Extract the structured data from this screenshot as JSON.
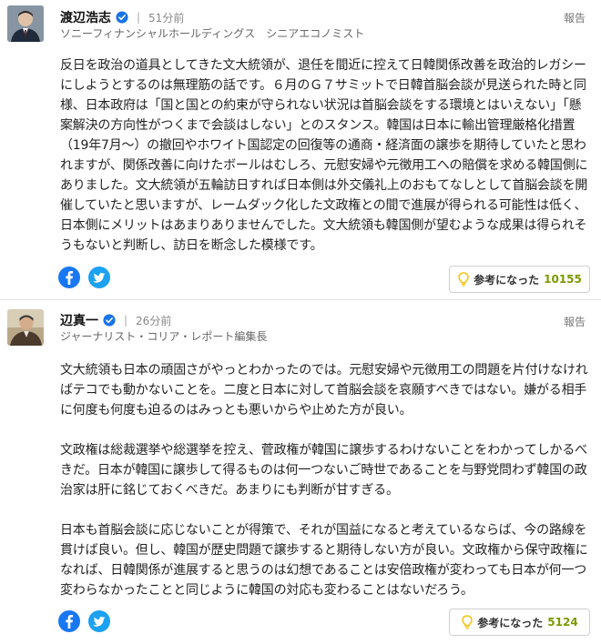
{
  "comments": [
    {
      "author": "渡辺浩志",
      "separator": "|",
      "time": "51分前",
      "affiliation": "ソニーフィナンシャルホールディングス　シニアエコノミスト",
      "report_label": "報告",
      "paragraphs": [
        "反日を政治の道具としてきた文大統領が、退任を間近に控えて日韓関係改善を政治的レガシーにしようとするのは無理筋の話です。６月のＧ７サミットで日韓首脳会談が見送られた時と同様、日本政府は「国と国との約束が守られない状況は首脳会談をする環境とはいえない」「懸案解決の方向性がつくまで会談はしない」とのスタンス。韓国は日本に輸出管理厳格化措置（19年7月〜）の撤回やホワイト国認定の回復等の通商・経済面の譲歩を期待していたと思われますが、関係改善に向けたボールはむしろ、元慰安婦や元徴用工への賠償を求める韓国側にありました。文大統領が五輪訪日すれば日本側は外交儀礼上のおもてなしとして首脳会談を開催していたと思いますが、レームダック化した文政権との間で進展が得られる可能性は低く、日本側にメリットはあまりありませんでした。文大統領も韓国側が望むような成果は得られそうもないと判断し、訪日を断念した模様です。"
      ],
      "helpful_label": "参考になった",
      "helpful_count": "10155"
    },
    {
      "author": "辺真一",
      "separator": "|",
      "time": "26分前",
      "affiliation": "ジャーナリスト・コリア・レポート編集長",
      "report_label": "報告",
      "paragraphs": [
        "文大統領も日本の頑固さがやっとわかったのでは。元慰安婦や元徴用工の問題を片付けなければテコでも動かないことを。二度と日本に対して首脳会談を哀願すべきではない。嫌がる相手に何度も何度も迫るのはみっとも悪いからや止めた方が良い。",
        "文政権は総裁選挙や総選挙を控え、菅政権が韓国に譲歩するわけないことをわかってしかるべきだ。日本が韓国に譲歩して得るものは何一つないご時世であることを与野党問わず韓国の政治家は肝に銘じておくべきだ。あまりにも判断が甘すぎる。",
        "日本も首脳会談に応じないことが得策で、それが国益になると考えているならば、今の路線を貫けば良い。但し、韓国が歴史問題で譲歩すると期待しない方が良い。文政権から保守政権になれば、日韓関係が進展すると思うのは幻想であることは安倍政権が変わっても日本が何一つ変わらなかったことと同じように韓国の対応も変わることはないだろう。"
      ],
      "helpful_label": "参考になった",
      "helpful_count": "5124"
    }
  ],
  "colors": {
    "verified": "#1a73e8",
    "facebook": "#1877f2",
    "twitter": "#1da1f2",
    "helpful_count": "#7a9a00",
    "bulb": "#f5c518"
  },
  "icons": [
    "avatar",
    "verified-badge-icon",
    "facebook-icon",
    "twitter-icon",
    "lightbulb-icon"
  ]
}
